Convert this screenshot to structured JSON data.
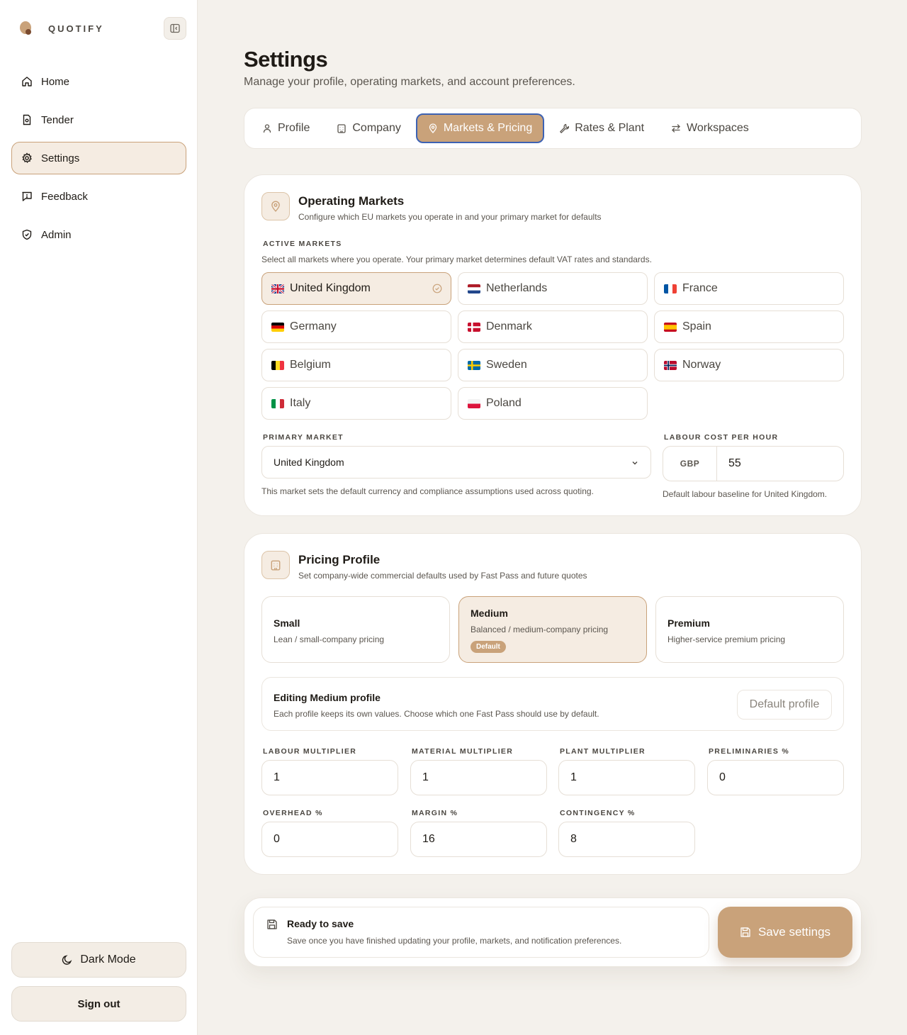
{
  "brand": {
    "name": "QUOTIFY"
  },
  "sidebar": {
    "items": [
      {
        "label": "Home",
        "icon": "home-icon"
      },
      {
        "label": "Tender",
        "icon": "document-icon"
      },
      {
        "label": "Settings",
        "icon": "gear-icon",
        "active": true
      },
      {
        "label": "Feedback",
        "icon": "message-icon"
      },
      {
        "label": "Admin",
        "icon": "shield-icon"
      }
    ],
    "dark_mode_label": "Dark Mode",
    "sign_out_label": "Sign out"
  },
  "page": {
    "title": "Settings",
    "subtitle": "Manage your profile, operating markets, and account preferences."
  },
  "tabs": [
    {
      "label": "Profile",
      "icon": "user-icon"
    },
    {
      "label": "Company",
      "icon": "building-icon"
    },
    {
      "label": "Markets & Pricing",
      "icon": "map-pin-icon",
      "active": true
    },
    {
      "label": "Rates & Plant",
      "icon": "wrench-icon"
    },
    {
      "label": "Workspaces",
      "icon": "swap-icon"
    }
  ],
  "markets_card": {
    "title": "Operating Markets",
    "description": "Configure which EU markets you operate in and your primary market for defaults",
    "active_label": "ACTIVE MARKETS",
    "active_help": "Select all markets where you operate. Your primary market determines default VAT rates and standards.",
    "markets": [
      {
        "name": "United Kingdom",
        "selected": true
      },
      {
        "name": "Netherlands"
      },
      {
        "name": "France"
      },
      {
        "name": "Germany"
      },
      {
        "name": "Denmark"
      },
      {
        "name": "Spain"
      },
      {
        "name": "Belgium"
      },
      {
        "name": "Sweden"
      },
      {
        "name": "Norway"
      },
      {
        "name": "Italy"
      },
      {
        "name": "Poland"
      }
    ],
    "primary_label": "PRIMARY MARKET",
    "primary_value": "United Kingdom",
    "primary_help": "This market sets the default currency and compliance assumptions used across quoting.",
    "labour_label": "LABOUR COST PER HOUR",
    "labour_currency": "GBP",
    "labour_value": "55",
    "labour_help": "Default labour baseline for United Kingdom."
  },
  "pricing_card": {
    "title": "Pricing Profile",
    "description": "Set company-wide commercial defaults used by Fast Pass and future quotes",
    "tiers": [
      {
        "name": "Small",
        "desc": "Lean / small-company pricing"
      },
      {
        "name": "Medium",
        "desc": "Balanced / medium-company pricing",
        "badge": "Default",
        "selected": true
      },
      {
        "name": "Premium",
        "desc": "Higher-service premium pricing"
      }
    ],
    "editing_title": "Editing Medium profile",
    "editing_desc": "Each profile keeps its own values. Choose which one Fast Pass should use by default.",
    "default_button": "Default profile",
    "fields": [
      {
        "label": "LABOUR MULTIPLIER",
        "value": "1"
      },
      {
        "label": "MATERIAL MULTIPLIER",
        "value": "1"
      },
      {
        "label": "PLANT MULTIPLIER",
        "value": "1"
      },
      {
        "label": "PRELIMINARIES %",
        "value": "0"
      },
      {
        "label": "OVERHEAD %",
        "value": "0"
      },
      {
        "label": "MARGIN %",
        "value": "16"
      },
      {
        "label": "CONTINGENCY %",
        "value": "8"
      }
    ]
  },
  "save_bar": {
    "title": "Ready to save",
    "description": "Save once you have finished updating your profile, markets, and notification preferences.",
    "button": "Save settings"
  },
  "colors": {
    "accent": "#c9a27a",
    "accent_soft": "#f5ece2",
    "background": "#f4f1ec",
    "focus_ring": "#3d62b3"
  }
}
